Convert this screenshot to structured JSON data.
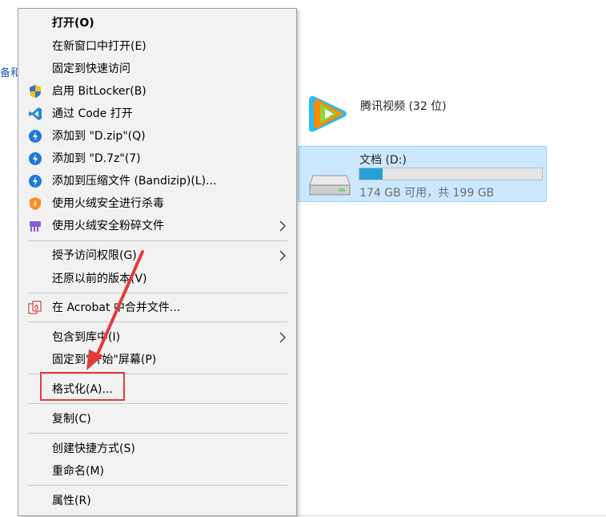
{
  "left_crumb": "备和",
  "apps_item": {
    "label": "腾讯视频 (32 位)",
    "icon": "tencent-video-icon"
  },
  "drive": {
    "label": "文档 (D:)",
    "size_text": "174 GB 可用，共 199 GB",
    "used_fraction": 0.126,
    "icon": "drive-icon"
  },
  "colors": {
    "menu_bg": "#f2f2f2",
    "selection_bg": "#cce8ff",
    "bar_fill": "#26a0da",
    "annotation_red": "#e23b3b"
  },
  "menu": {
    "items": [
      {
        "label": "打开(O)",
        "bold": true
      },
      {
        "label": "在新窗口中打开(E)"
      },
      {
        "label": "固定到快速访问"
      },
      {
        "label": "启用 BitLocker(B)",
        "icon": "shield-icon"
      },
      {
        "label": "通过 Code 打开",
        "icon": "vscode-icon"
      },
      {
        "label": "添加到 \"D.zip\"(Q)",
        "icon": "bandizip-icon"
      },
      {
        "label": "添加到 \"D.7z\"(7)",
        "icon": "bandizip-icon"
      },
      {
        "label": "添加到压缩文件 (Bandizip)(L)...",
        "icon": "bandizip-icon"
      },
      {
        "label": "使用火绒安全进行杀毒",
        "icon": "huorong-icon"
      },
      {
        "label": "使用火绒安全粉碎文件",
        "icon": "shredder-icon",
        "submenu": true
      },
      {
        "label": "授予访问权限(G)",
        "submenu": true
      },
      {
        "label": "还原以前的版本(V)"
      },
      {
        "label": "在 Acrobat 中合并文件...",
        "icon": "acrobat-icon"
      },
      {
        "label": "包含到库中(I)",
        "submenu": true
      },
      {
        "label": "固定到\"开始\"屏幕(P)"
      },
      {
        "label": "格式化(A)..."
      },
      {
        "label": "复制(C)"
      },
      {
        "label": "创建快捷方式(S)"
      },
      {
        "label": "重命名(M)"
      },
      {
        "label": "属性(R)"
      }
    ]
  }
}
